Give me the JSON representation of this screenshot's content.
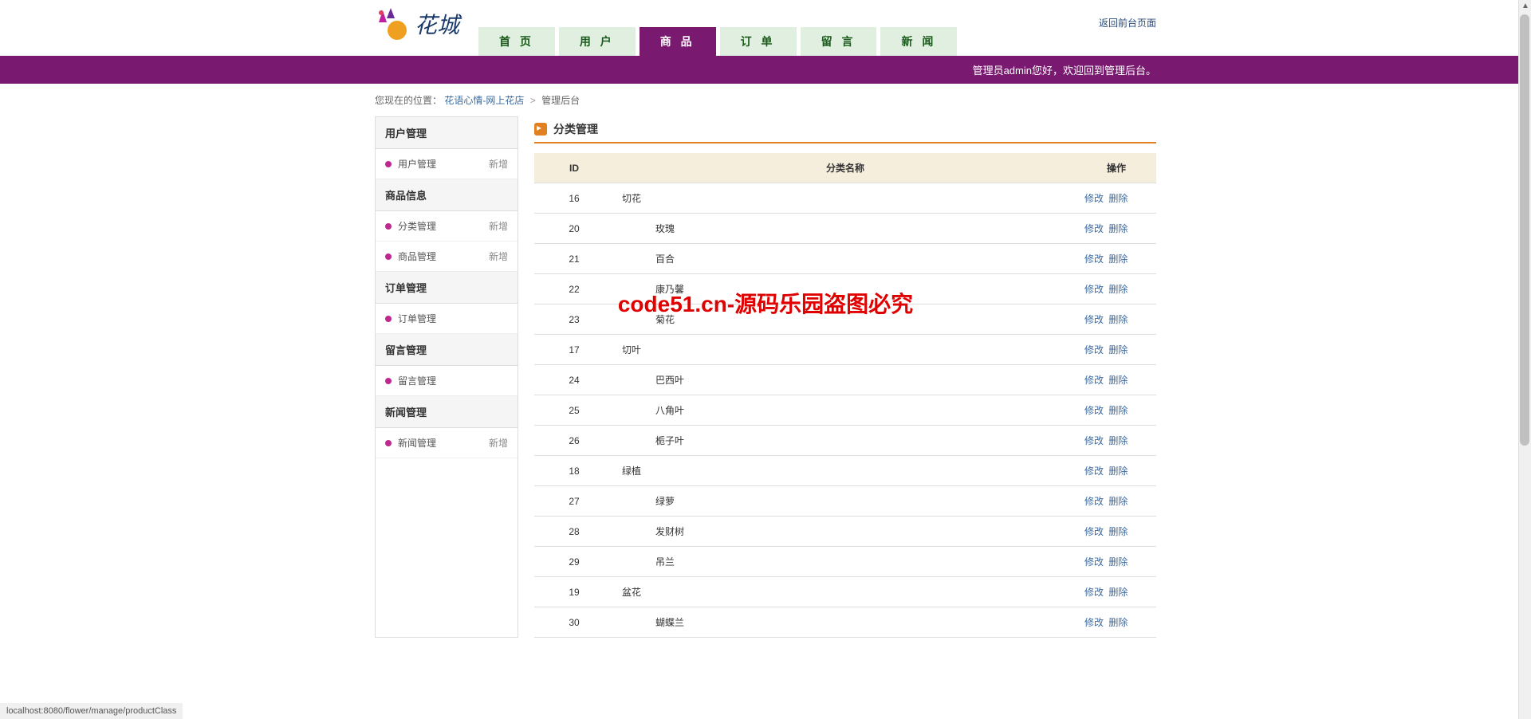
{
  "header": {
    "logo_text": "花城",
    "back_link": "返回前台页面"
  },
  "nav": [
    {
      "label": "首 页",
      "active": false
    },
    {
      "label": "用 户",
      "active": false
    },
    {
      "label": "商 品",
      "active": true
    },
    {
      "label": "订 单",
      "active": false
    },
    {
      "label": "留 言",
      "active": false
    },
    {
      "label": "新 闻",
      "active": false
    }
  ],
  "banner": "管理员admin您好，欢迎回到管理后台。",
  "breadcrumb": {
    "prefix": "您现在的位置：",
    "link1": "花语心情-网上花店",
    "sep": ">",
    "current": "管理后台"
  },
  "sidebar": [
    {
      "title": "用户管理",
      "items": [
        {
          "label": "用户管理",
          "add": "新增"
        }
      ]
    },
    {
      "title": "商品信息",
      "items": [
        {
          "label": "分类管理",
          "add": "新增"
        },
        {
          "label": "商品管理",
          "add": "新增"
        }
      ]
    },
    {
      "title": "订单管理",
      "items": [
        {
          "label": "订单管理",
          "add": ""
        }
      ]
    },
    {
      "title": "留言管理",
      "items": [
        {
          "label": "留言管理",
          "add": ""
        }
      ]
    },
    {
      "title": "新闻管理",
      "items": [
        {
          "label": "新闻管理",
          "add": "新增"
        }
      ]
    }
  ],
  "content": {
    "title": "分类管理",
    "columns": {
      "id": "ID",
      "name": "分类名称",
      "op": "操作"
    },
    "op_edit": "修改",
    "op_delete": "删除",
    "rows": [
      {
        "id": "16",
        "name": "切花",
        "indent": false
      },
      {
        "id": "20",
        "name": "玫瑰",
        "indent": true
      },
      {
        "id": "21",
        "name": "百合",
        "indent": true
      },
      {
        "id": "22",
        "name": "康乃馨",
        "indent": true
      },
      {
        "id": "23",
        "name": "菊花",
        "indent": true
      },
      {
        "id": "17",
        "name": "切叶",
        "indent": false
      },
      {
        "id": "24",
        "name": "巴西叶",
        "indent": true
      },
      {
        "id": "25",
        "name": "八角叶",
        "indent": true
      },
      {
        "id": "26",
        "name": "栀子叶",
        "indent": true
      },
      {
        "id": "18",
        "name": "绿植",
        "indent": false
      },
      {
        "id": "27",
        "name": "绿萝",
        "indent": true
      },
      {
        "id": "28",
        "name": "发财树",
        "indent": true
      },
      {
        "id": "29",
        "name": "吊兰",
        "indent": true
      },
      {
        "id": "19",
        "name": "盆花",
        "indent": false
      },
      {
        "id": "30",
        "name": "蝴蝶兰",
        "indent": true
      }
    ]
  },
  "watermark": "code51.cn-源码乐园盗图必究",
  "status_bar": "localhost:8080/flower/manage/productClass"
}
